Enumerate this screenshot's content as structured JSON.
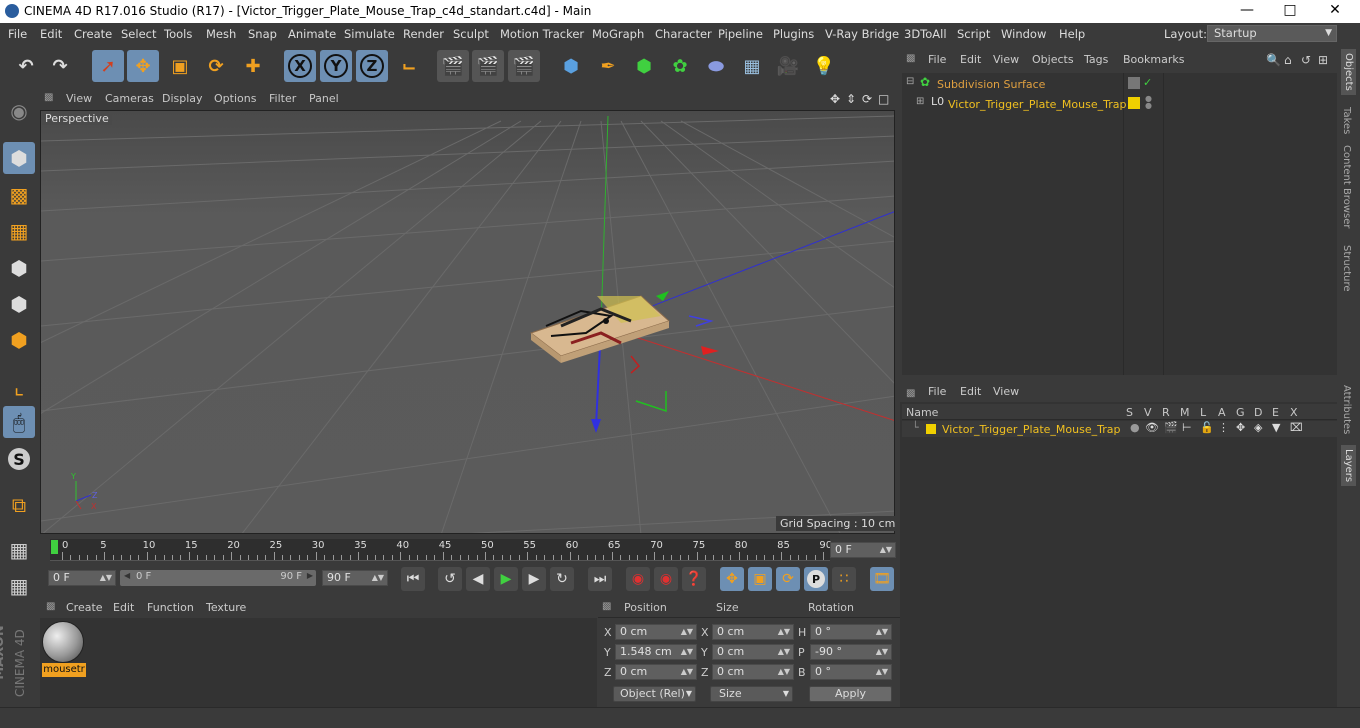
{
  "window": {
    "title": "CINEMA 4D R17.016 Studio (R17) - [Victor_Trigger_Plate_Mouse_Trap_c4d_standart.c4d] - Main",
    "controls": [
      "minimize",
      "maximize",
      "close"
    ]
  },
  "menubar": {
    "items": [
      "File",
      "Edit",
      "Create",
      "Select",
      "Tools",
      "Mesh",
      "Snap",
      "Animate",
      "Simulate",
      "Render",
      "Sculpt",
      "Motion Tracker",
      "MoGraph",
      "Character",
      "Pipeline",
      "Plugins",
      "V-Ray Bridge",
      "3DToAll",
      "Script",
      "Window",
      "Help"
    ],
    "layout_label": "Layout:",
    "layout_value": "Startup"
  },
  "toolbar": {
    "icons": [
      "undo-icon",
      "redo-icon",
      "live-selection-icon",
      "move-icon",
      "scale-icon",
      "rotate-icon",
      "recent-tool-icon",
      "x-axis-icon",
      "y-axis-icon",
      "z-axis-icon",
      "coordinate-system-icon",
      "render-view-icon",
      "render-picture-viewer-icon",
      "edit-render-settings-icon",
      "cube-icon",
      "pen-icon",
      "subdivision-icon",
      "array-icon",
      "deformer-icon",
      "floor-icon",
      "camera-icon",
      "light-icon"
    ],
    "axis_labels": [
      "X",
      "Y",
      "Z"
    ]
  },
  "left_toolbar": {
    "icons": [
      "make-editable-icon",
      "model-mode-icon",
      "texture-mode-icon",
      "workplane-icon",
      "points-mode-icon",
      "edges-mode-icon",
      "polygons-mode-icon",
      "axis-mode-icon",
      "tweak-icon",
      "snap-s-icon",
      "magnet-icon",
      "grid-icon",
      "locked-workplane-icon"
    ]
  },
  "viewport": {
    "menu": [
      "View",
      "Cameras",
      "Display",
      "Options",
      "Filter",
      "Panel"
    ],
    "label": "Perspective",
    "grid_spacing": "Grid Spacing : 10 cm",
    "axis_letters": {
      "x": "X",
      "y": "Y",
      "z": "Z"
    }
  },
  "timeline": {
    "ticks": [
      "0",
      "5",
      "10",
      "15",
      "20",
      "25",
      "30",
      "35",
      "40",
      "45",
      "50",
      "55",
      "60",
      "65",
      "70",
      "75",
      "80",
      "85",
      "90"
    ],
    "current_frame_field": "0 F"
  },
  "playback": {
    "start_field": "0 F",
    "range_start": "0 F",
    "range_end": "90 F",
    "end_field": "90 F"
  },
  "material_manager": {
    "menu": [
      "Create",
      "Edit",
      "Function",
      "Texture"
    ],
    "materials": [
      {
        "name": "mousetr"
      }
    ]
  },
  "coordinates": {
    "headers": [
      "Position",
      "Size",
      "Rotation"
    ],
    "rows": [
      {
        "axis": "X",
        "pos": "0 cm",
        "size_axis": "X",
        "size": "0 cm",
        "rot_axis": "H",
        "rot": "0 °"
      },
      {
        "axis": "Y",
        "pos": "1.548 cm",
        "size_axis": "Y",
        "size": "0 cm",
        "rot_axis": "P",
        "rot": "-90 °"
      },
      {
        "axis": "Z",
        "pos": "0 cm",
        "size_axis": "Z",
        "size": "0 cm",
        "rot_axis": "B",
        "rot": "0 °"
      }
    ],
    "mode_select": "Object (Rel)",
    "size_select": "Size",
    "apply_label": "Apply"
  },
  "object_manager": {
    "menu": [
      "File",
      "Edit",
      "View",
      "Objects",
      "Tags",
      "Bookmarks"
    ],
    "objects": [
      {
        "name": "Subdivision Surface",
        "color": "#e0a040"
      },
      {
        "name": "Victor_Trigger_Plate_Mouse_Trap",
        "color": "#f0d000"
      }
    ]
  },
  "layer_manager": {
    "menu": [
      "File",
      "Edit",
      "View"
    ],
    "columns": [
      "Name",
      "S",
      "V",
      "R",
      "M",
      "L",
      "A",
      "G",
      "D",
      "E",
      "X"
    ],
    "layers": [
      {
        "name": "Victor_Trigger_Plate_Mouse_Trap",
        "color": "#f0d000"
      }
    ]
  },
  "right_tabs": [
    "Objects",
    "Takes",
    "Content Browser",
    "Structure",
    "Attributes",
    "Layers"
  ],
  "branding": {
    "line1": "MAXON",
    "line2": "CINEMA 4D"
  },
  "colors": {
    "accent": "#6d8fb3",
    "selected_text": "#f0c020",
    "bg": "#3a3a3a"
  }
}
